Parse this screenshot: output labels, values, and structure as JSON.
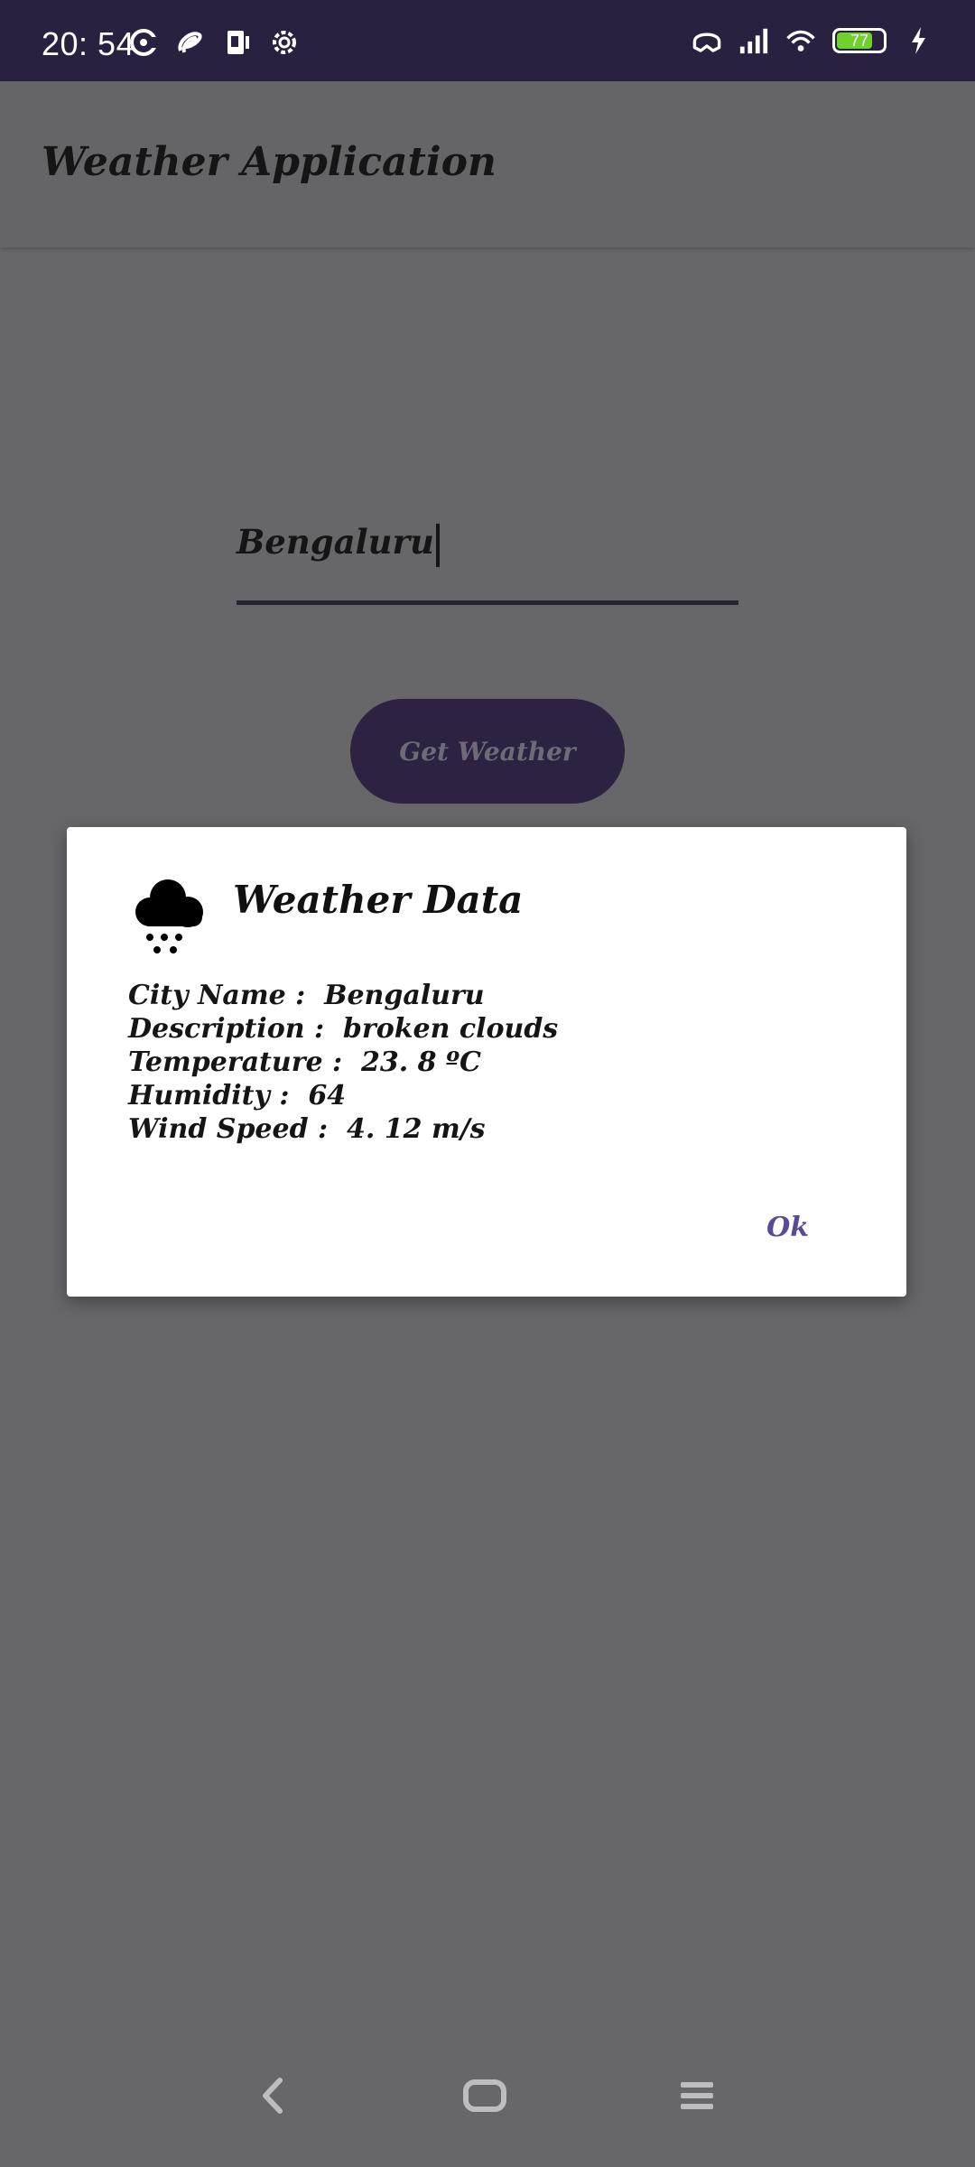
{
  "status_bar": {
    "time": "20: 54",
    "battery_level": "77",
    "icons_left": [
      "sync-icon",
      "airtel-icon",
      "sim-card-icon",
      "settings-icon"
    ],
    "icons_right": [
      "headset-icon",
      "signal-icon",
      "wifi-icon",
      "battery-icon",
      "charging-icon"
    ]
  },
  "app_bar": {
    "title": "Weather Application"
  },
  "city_input": {
    "value": "Bengaluru"
  },
  "get_weather_button": {
    "label": "Get Weather"
  },
  "dialog": {
    "title": "Weather Data",
    "icon": "snow-cloud-icon",
    "lines": [
      "City Name :  Bengaluru",
      "Description :  broken clouds",
      "Temperature :  23. 8 ºC",
      "Humidity :  64",
      "Wind Speed :  4. 12 m/s"
    ],
    "ok_label": "Ok"
  },
  "colors": {
    "status_bar": "#2a2141",
    "background_dim": "#676669",
    "button": "#2d2242",
    "accent": "#5a4a93",
    "battery": "#6fd12b"
  }
}
